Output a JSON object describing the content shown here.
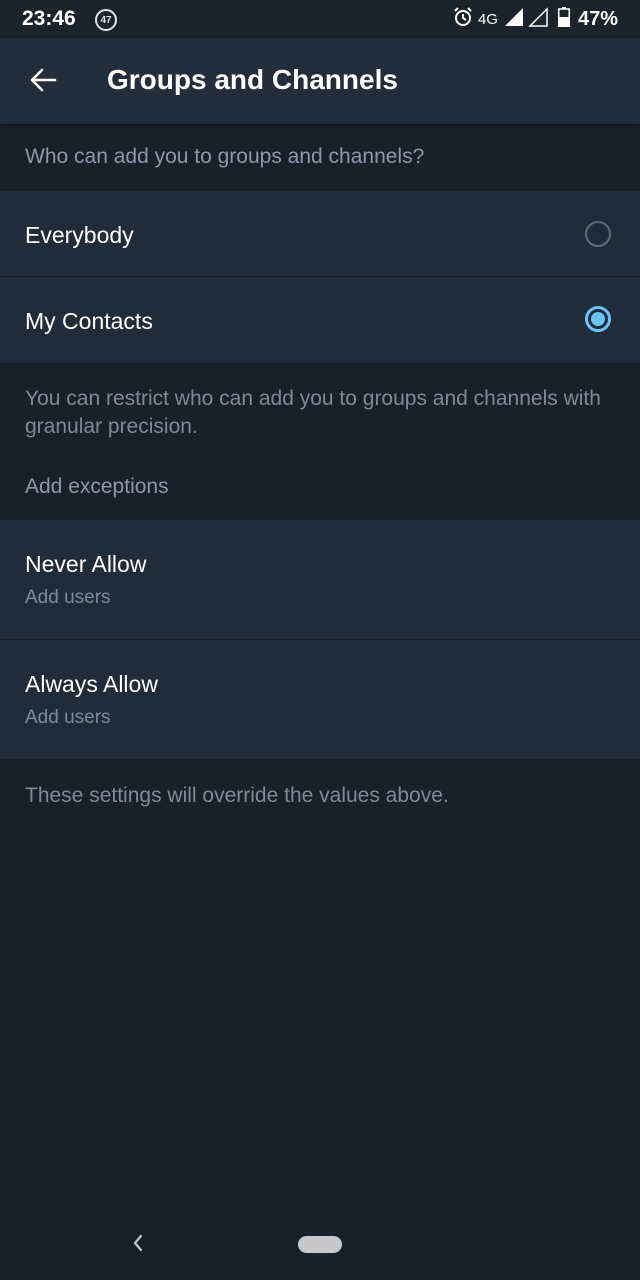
{
  "status_bar": {
    "time": "23:46",
    "notification_count": "47",
    "network": "4G",
    "battery": "47%"
  },
  "app_bar": {
    "title": "Groups and Channels"
  },
  "who_can_add": {
    "header": "Who can add you to groups and channels?",
    "options": [
      {
        "label": "Everybody",
        "selected": false
      },
      {
        "label": "My Contacts",
        "selected": true
      }
    ],
    "info": "You can restrict who can add you to groups and channels with granular precision."
  },
  "exceptions": {
    "header": "Add exceptions",
    "items": [
      {
        "title": "Never Allow",
        "subtitle": "Add users"
      },
      {
        "title": "Always Allow",
        "subtitle": "Add users"
      }
    ],
    "footer": "These settings will override the values above."
  },
  "colors": {
    "background": "#18202a",
    "surface": "#212c3a",
    "app_bar": "#232e3c",
    "accent": "#6ac4f7",
    "secondary_text": "#7d8b99"
  }
}
